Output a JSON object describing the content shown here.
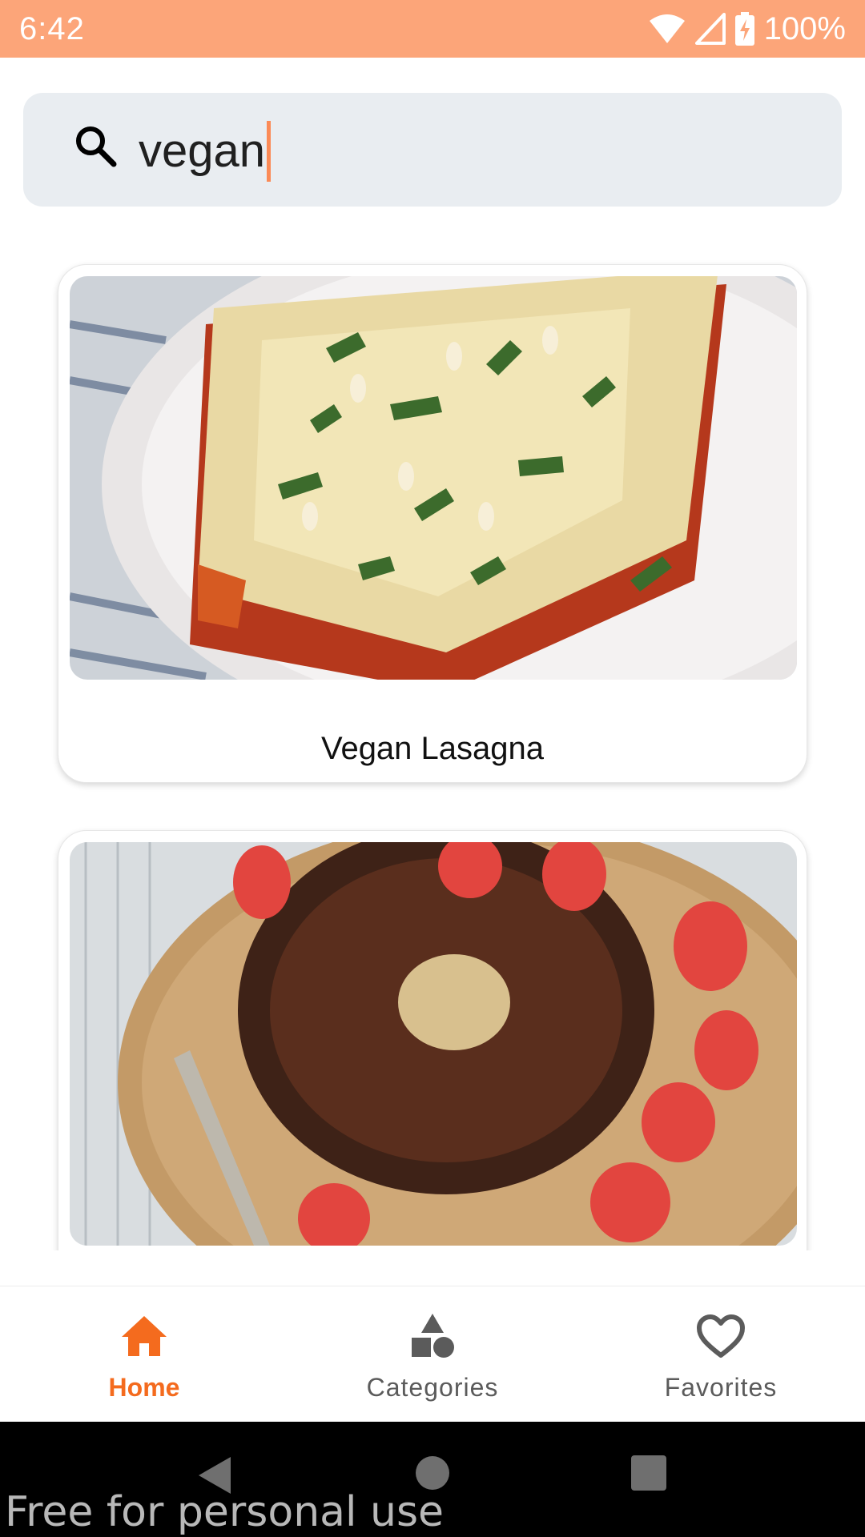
{
  "status_bar": {
    "time": "6:42",
    "battery": "100%",
    "icons": [
      "wifi-icon",
      "signal-icon",
      "battery-charging-icon"
    ],
    "background": "#fca579"
  },
  "search": {
    "value": "vegan",
    "icon": "search-icon"
  },
  "results": [
    {
      "title": "Vegan Lasagna",
      "image": "vegan-lasagna-photo"
    },
    {
      "title": "",
      "image": "chocolate-bundt-cake-with-strawberries-photo"
    }
  ],
  "bottom_nav": {
    "items": [
      {
        "label": "Home",
        "icon": "home-icon",
        "active": true
      },
      {
        "label": "Categories",
        "icon": "shapes-icon",
        "active": false
      },
      {
        "label": "Favorites",
        "icon": "heart-outline-icon",
        "active": false
      }
    ],
    "active_color": "#f46b1e"
  },
  "system_nav": {
    "buttons": [
      "back-icon",
      "home-circle-icon",
      "recents-icon"
    ]
  },
  "watermark": "Free for personal use"
}
